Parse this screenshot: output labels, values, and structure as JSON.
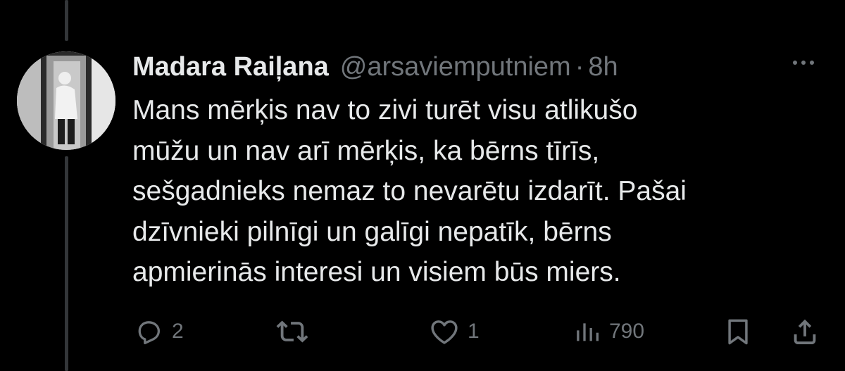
{
  "tweet": {
    "author_name": "Madara Raiļana",
    "author_handle": "@arsaviemputniem",
    "separator": "·",
    "time": "8h",
    "text_lines": [
      "Mans mērķis nav to zivi turēt visu atlikušo",
      "mūžu un nav arī mērķis, ka bērns tīrīs,",
      "sešgadnieks nemaz to nevarētu izdarīt. Pašai",
      "dzīvnieki pilnīgi un galīgi nepatīk, bērns",
      "apmierinās interesi un visiem būs miers."
    ]
  },
  "actions": {
    "replies": "2",
    "retweets": "",
    "likes": "1",
    "views": "790"
  },
  "icons": {
    "reply": "reply-icon",
    "retweet": "retweet-icon",
    "like": "heart-icon",
    "views": "views-icon",
    "bookmark": "bookmark-icon",
    "share": "share-icon",
    "more": "more-icon"
  },
  "colors": {
    "background": "#000000",
    "text": "#e7e9ea",
    "secondary": "#71767b",
    "thread_line": "#333639"
  }
}
